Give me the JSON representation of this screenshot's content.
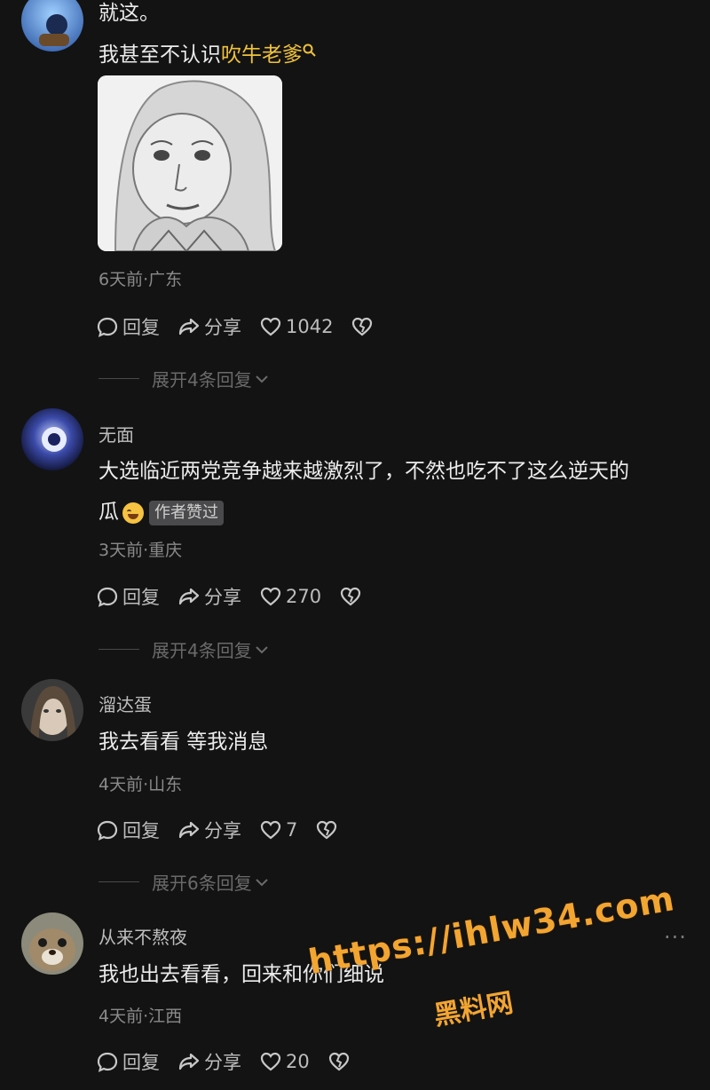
{
  "comments": [
    {
      "lines": [
        "就这。"
      ],
      "text2_plain": "我甚至不认识",
      "text2_link": "吹牛老爹",
      "meta": "6天前·广东",
      "reply_label": "回复",
      "share_label": "分享",
      "likes": "1042",
      "expand": "展开4条回复"
    },
    {
      "name": "无面",
      "line1": "大选临近两党竞争越来越激烈了，不然也吃不了这么逆天的",
      "line2": "瓜",
      "badge": "作者赞过",
      "meta": "3天前·重庆",
      "reply_label": "回复",
      "share_label": "分享",
      "likes": "270",
      "expand": "展开4条回复"
    },
    {
      "name": "溜达蛋",
      "text": "我去看看 等我消息",
      "meta": "4天前·山东",
      "reply_label": "回复",
      "share_label": "分享",
      "likes": "7",
      "expand": "展开6条回复"
    },
    {
      "name": "从来不熬夜",
      "text": "我也出去看看，回来和你们细说",
      "meta": "4天前·江西",
      "reply_label": "回复",
      "share_label": "分享",
      "likes": "20",
      "more": "···"
    }
  ],
  "watermark": {
    "url": "https://ihlw34.com",
    "name": "黑料网"
  },
  "colors": {
    "background": "#131313",
    "link": "#f0c23a",
    "watermark": "#f3a531"
  }
}
